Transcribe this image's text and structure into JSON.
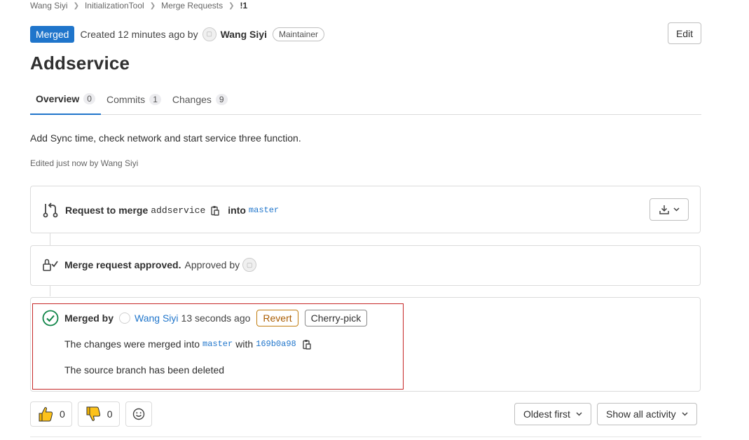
{
  "breadcrumb": {
    "items": [
      "Wang Siyi",
      "InitializationTool",
      "Merge Requests"
    ],
    "current": "!1"
  },
  "header": {
    "status": "Merged",
    "created_text": "Created 12 minutes ago by",
    "author": "Wang Siyi",
    "role": "Maintainer",
    "edit_label": "Edit"
  },
  "title": "Addservice",
  "tabs": [
    {
      "label": "Overview",
      "count": "0"
    },
    {
      "label": "Commits",
      "count": "1"
    },
    {
      "label": "Changes",
      "count": "9"
    }
  ],
  "description": "Add Sync time, check network and start service three function.",
  "edited": "Edited just now by Wang Siyi",
  "request": {
    "prefix": "Request to merge",
    "source_branch": "addservice",
    "into": "into",
    "target_branch": "master"
  },
  "approval": {
    "title": "Merge request approved.",
    "approved_by": "Approved by"
  },
  "merged": {
    "merged_by_label": "Merged by",
    "user": "Wang Siyi",
    "time": "13 seconds ago",
    "revert_label": "Revert",
    "cherry_pick_label": "Cherry-pick",
    "changes_prefix": "The changes were merged into",
    "target_branch": "master",
    "with": "with",
    "commit": "169b0a98",
    "source_deleted": "The source branch has been deleted"
  },
  "reactions": {
    "thumbs_up": "0",
    "thumbs_down": "0"
  },
  "sort": {
    "order": "Oldest first",
    "activity": "Show all activity"
  },
  "colors": {
    "primary": "#1f75cb",
    "merged_badge": "#1f75cb",
    "success": "#108548",
    "revert": "#c17d10",
    "highlight": "#c62828"
  }
}
